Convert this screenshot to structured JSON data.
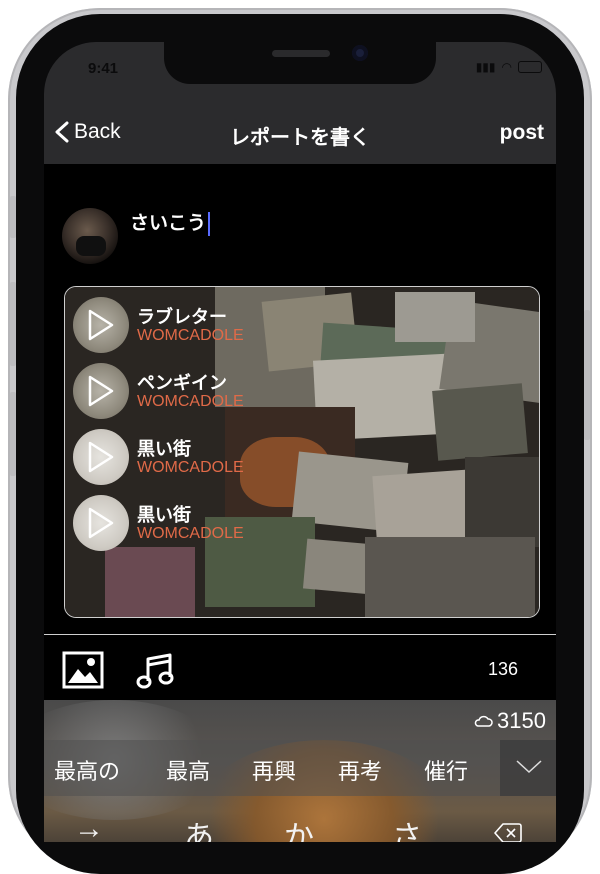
{
  "status": {
    "time": "9:41"
  },
  "nav": {
    "back_label": "Back",
    "title": "レポートを書く",
    "post_label": "post"
  },
  "user": {
    "name": "さいこう"
  },
  "tracks": [
    {
      "title": "ラブレター",
      "artist": "WOMCADOLE"
    },
    {
      "title": "ペンギイン",
      "artist": "WOMCADOLE"
    },
    {
      "title": "黒い街",
      "artist": "WOMCADOLE"
    },
    {
      "title": "黒い街",
      "artist": "WOMCADOLE"
    }
  ],
  "toolbar": {
    "count": "136",
    "icons": [
      "image-icon",
      "music-note-icon"
    ]
  },
  "keyboard": {
    "cloud_count": "3150",
    "suggestions": [
      "最高の",
      "最高",
      "再興",
      "再考",
      "催行"
    ],
    "keys": [
      "→",
      "あ",
      "か",
      "さ"
    ]
  },
  "colors": {
    "artist": "#e06a48",
    "nav_bg": "#2b2b2d",
    "caret": "#5a6cff"
  }
}
